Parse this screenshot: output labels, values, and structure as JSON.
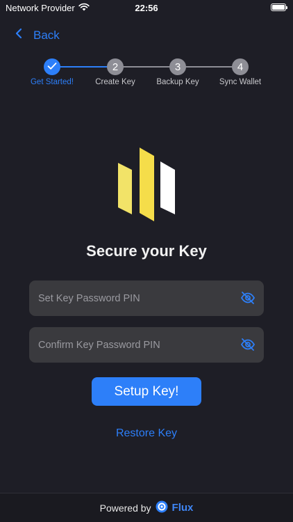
{
  "status": {
    "carrier": "Network Provider",
    "time": "22:56",
    "wifi_icon": "wifi-icon",
    "battery_icon": "battery-icon"
  },
  "nav": {
    "back_label": "Back",
    "back_icon": "chevron-left-icon"
  },
  "stepper": {
    "steps": [
      {
        "number": "1",
        "label": "Get Started!",
        "state": "done"
      },
      {
        "number": "2",
        "label": "Create Key",
        "state": "pending"
      },
      {
        "number": "3",
        "label": "Backup Key",
        "state": "pending"
      },
      {
        "number": "4",
        "label": "Sync Wallet",
        "state": "pending"
      }
    ]
  },
  "main": {
    "title": "Secure your Key",
    "pin_field": {
      "value": "",
      "placeholder": "Set Key Password PIN",
      "toggle_icon": "eye-slash-icon"
    },
    "confirm_field": {
      "value": "",
      "placeholder": "Confirm Key Password PIN",
      "toggle_icon": "eye-slash-icon"
    },
    "setup_button": "Setup Key!",
    "restore_link": "Restore Key"
  },
  "footer": {
    "powered_by": "Powered by",
    "brand": "Flux",
    "brand_icon": "flux-logo-icon"
  },
  "colors": {
    "accent": "#2d7ff9",
    "background": "#1e1e26",
    "field_bg": "#3a3a3e",
    "logo_yellow": "#f5dd4a",
    "logo_white": "#ffffff"
  }
}
